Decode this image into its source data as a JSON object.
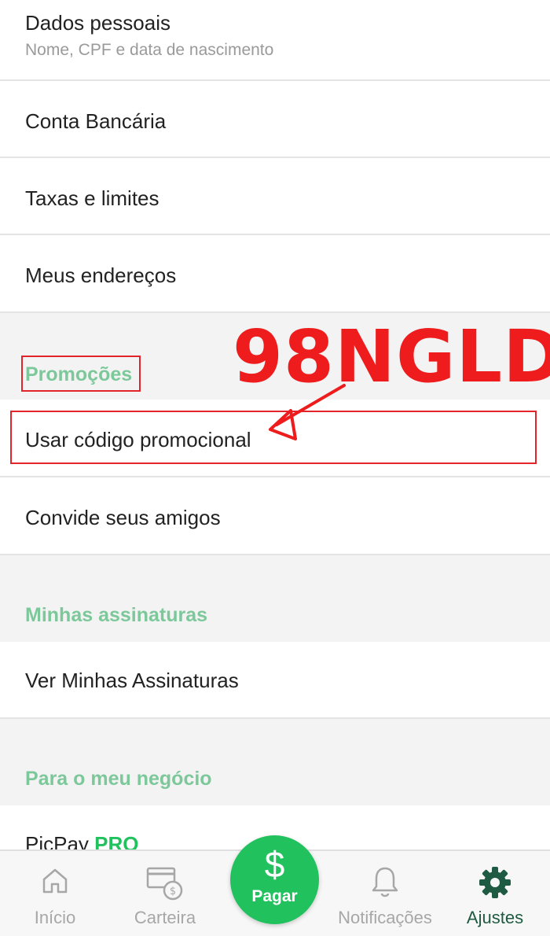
{
  "menu": {
    "personal_data": {
      "label": "Dados pessoais",
      "sub": "Nome, CPF e data de nascimento"
    },
    "bank_account": "Conta Bancária",
    "fees_limits": "Taxas e limites",
    "addresses": "Meus endereços"
  },
  "sections": {
    "promotions": {
      "title": "Promoções",
      "items": [
        "Usar código promocional",
        "Convide seus amigos"
      ]
    },
    "subscriptions": {
      "title": "Minhas assinaturas",
      "items": [
        "Ver Minhas Assinaturas"
      ]
    },
    "business": {
      "title": "Para o meu negócio",
      "item_prefix": "PicPay",
      "item_badge": "PRO"
    }
  },
  "annotation": {
    "promo_code": "98NGLD",
    "color": "#ee1c1c"
  },
  "tabbar": {
    "home": "Início",
    "wallet": "Carteira",
    "pay": "Pagar",
    "pay_symbol": "$",
    "notifications": "Notificações",
    "settings": "Ajustes"
  },
  "colors": {
    "brand_green": "#21c25e",
    "section_green": "#7cc89a",
    "active_tab": "#1f5a43"
  }
}
